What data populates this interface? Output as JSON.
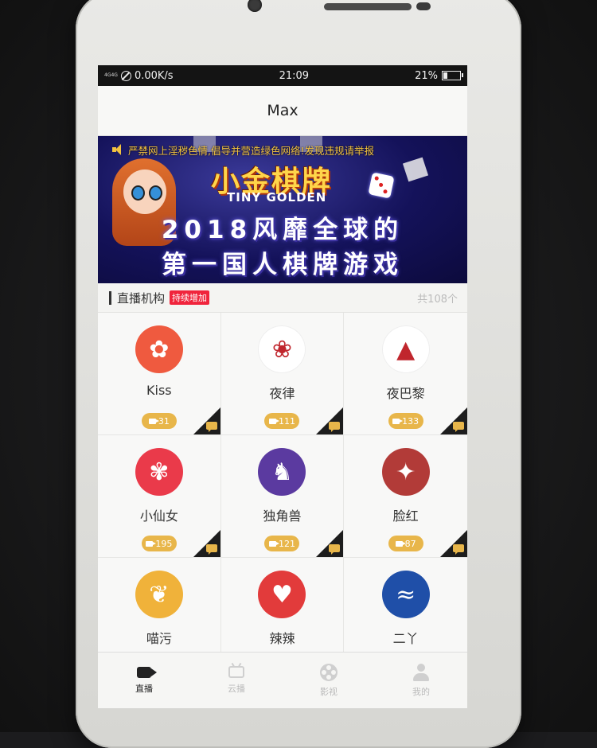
{
  "status_bar": {
    "signal_text": "4G4G",
    "net_speed": "0.00K/s",
    "time": "21:09",
    "battery": "21%",
    "battery_level": 0.21
  },
  "header": {
    "title": "Max"
  },
  "banner": {
    "marquee": "严禁网上淫秽色情,倡导并营造绿色网络!发现违规请举报",
    "logo_title": "小金棋牌",
    "logo_subtitle": "TINY GOLDEN",
    "headline_line1": "2018风靡全球的",
    "headline_line2": "第一国人棋牌游戏"
  },
  "section": {
    "title": "直播机构",
    "badge": "持续增加",
    "count": "共108个"
  },
  "platforms": [
    {
      "name": "Kiss",
      "viewers": "31",
      "icon": "fairy-icon",
      "avatar_color": "#ef5a3f"
    },
    {
      "name": "夜律",
      "viewers": "111",
      "icon": "red-lady-logo-icon",
      "avatar_color": "#ffffff"
    },
    {
      "name": "夜巴黎",
      "viewers": "133",
      "icon": "eiffel-tower-logo-icon",
      "avatar_color": "#ffffff"
    },
    {
      "name": "小仙女",
      "viewers": "195",
      "icon": "fairy-girl-icon",
      "avatar_color": "#ea3a4a"
    },
    {
      "name": "独角兽",
      "viewers": "121",
      "icon": "unicorn-icon",
      "avatar_color": "#5b3aa0"
    },
    {
      "name": "脸红",
      "viewers": "87",
      "icon": "anime-girl-icon",
      "avatar_color": "#b23b38"
    },
    {
      "name": "喵污",
      "viewers": "",
      "icon": "bunny-girl-icon",
      "avatar_color": "#f0b23a"
    },
    {
      "name": "辣辣",
      "viewers": "",
      "icon": "woman-photo-icon",
      "avatar_color": "#e23b3b"
    },
    {
      "name": "二丫",
      "viewers": "",
      "icon": "mermaid-icon",
      "avatar_color": "#1f4fa8"
    }
  ],
  "tabs": [
    {
      "label": "直播",
      "icon": "video-camera-icon",
      "active": true
    },
    {
      "label": "云播",
      "icon": "tv-icon",
      "active": false
    },
    {
      "label": "影视",
      "icon": "film-reel-icon",
      "active": false
    },
    {
      "label": "我的",
      "icon": "user-icon",
      "active": false
    }
  ]
}
